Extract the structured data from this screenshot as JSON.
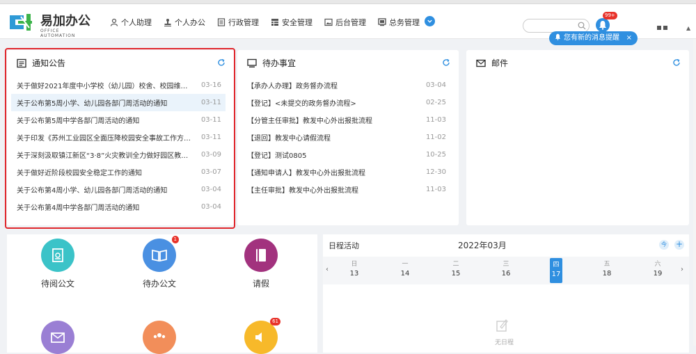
{
  "app": {
    "title": "易加办公",
    "subtitle": "OFFICE AUTOMATION"
  },
  "nav": [
    {
      "label": "个人助理",
      "icon": "user-icon"
    },
    {
      "label": "个人办公",
      "icon": "stamp-icon"
    },
    {
      "label": "行政管理",
      "icon": "document-icon"
    },
    {
      "label": "安全管理",
      "icon": "grid-icon"
    },
    {
      "label": "后台管理",
      "icon": "image-icon"
    },
    {
      "label": "总务管理",
      "icon": "monitor-icon"
    }
  ],
  "header": {
    "search_placeholder": "",
    "bell_badge": "99+",
    "notice": "您有新的消息提醒",
    "notice_close": "×"
  },
  "announcements": {
    "title": "通知公告",
    "items": [
      {
        "text": "关于做好2021年度中小学校（幼儿园）校舍、校园维修...",
        "date": "03-16"
      },
      {
        "text": "关于公布第5周小学、幼儿园各部门周活动的通知",
        "date": "03-11"
      },
      {
        "text": "关于公布第5周中学各部门周活动的通知",
        "date": "03-11"
      },
      {
        "text": "关于印发《苏州工业园区全面压降校园安全事故工作方案...",
        "date": "03-11"
      },
      {
        "text": "关于深刻汲取镇江新区“3·8”火灾教训全力做好园区教育系...",
        "date": "03-09"
      },
      {
        "text": "关于做好近阶段校园安全稳定工作的通知",
        "date": "03-07"
      },
      {
        "text": "关于公布第4周小学、幼儿园各部门周活动的通知",
        "date": "03-04"
      },
      {
        "text": "关于公布第4周中学各部门周活动的通知",
        "date": "03-04"
      }
    ]
  },
  "todo": {
    "title": "待办事宜",
    "items": [
      {
        "text": "【承办人办理】政务督办流程",
        "date": "03-04"
      },
      {
        "text": "【登记】<未提交的政务督办流程>",
        "date": "02-25"
      },
      {
        "text": "【分管主任审批】教发中心外出报批流程",
        "date": "11-03"
      },
      {
        "text": "【退回】教发中心请假流程",
        "date": "11-02"
      },
      {
        "text": "【登记】测试0805",
        "date": "10-25"
      },
      {
        "text": "【通知申请人】教发中心外出报批流程",
        "date": "12-30"
      },
      {
        "text": "【主任审批】教发中心外出报批流程",
        "date": "11-03"
      }
    ]
  },
  "mail": {
    "title": "邮件"
  },
  "apps": [
    {
      "label": "待阅公文",
      "color": "#3bc3c8",
      "badge": ""
    },
    {
      "label": "待办公文",
      "color": "#4a90e2",
      "badge": "1"
    },
    {
      "label": "请假",
      "color": "#a2327e",
      "badge": ""
    },
    {
      "label": "",
      "color": "#9a7fd4",
      "badge": ""
    },
    {
      "label": "",
      "color": "#f28e5a",
      "badge": ""
    },
    {
      "label": "",
      "color": "#f7b92a",
      "badge": "61"
    }
  ],
  "calendar": {
    "title": "日程活动",
    "month": "2022年03月",
    "today_btn": "今",
    "add_btn": "+",
    "prev": "‹",
    "next": "›",
    "days": [
      {
        "wd": "日",
        "dn": "13"
      },
      {
        "wd": "一",
        "dn": "14"
      },
      {
        "wd": "二",
        "dn": "15"
      },
      {
        "wd": "三",
        "dn": "16"
      },
      {
        "wd": "四",
        "dn": "17"
      },
      {
        "wd": "五",
        "dn": "18"
      },
      {
        "wd": "六",
        "dn": "19"
      }
    ],
    "empty": "无日程"
  }
}
